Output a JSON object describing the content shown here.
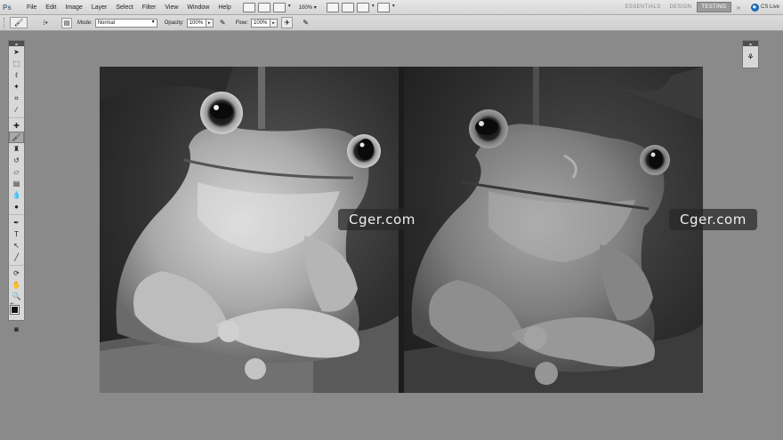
{
  "app": {
    "logo": "Ps"
  },
  "menu": [
    "File",
    "Edit",
    "Image",
    "Layer",
    "Select",
    "Filter",
    "View",
    "Window",
    "Help"
  ],
  "toolbar": {
    "zoom": "100%"
  },
  "workspaces": {
    "items": [
      "ESSENTIALS",
      "DESIGN",
      "TESTING"
    ],
    "active": "TESTING",
    "more": "»",
    "cs_live": "CS Live"
  },
  "options": {
    "mode_label": "Mode:",
    "mode_value": "Normal",
    "opacity_label": "Opacity:",
    "opacity_value": "100%",
    "flow_label": "Flow:",
    "flow_value": "100%"
  },
  "canvas": {
    "left_image": "grayscale-frog-photo",
    "right_image": "grayscale-frog-painting"
  },
  "watermarks": [
    "Cger.com",
    "Cger.com"
  ],
  "colors": {
    "foreground": "#111111",
    "background": "#ffffff",
    "workspace": "#8a8a8a"
  }
}
